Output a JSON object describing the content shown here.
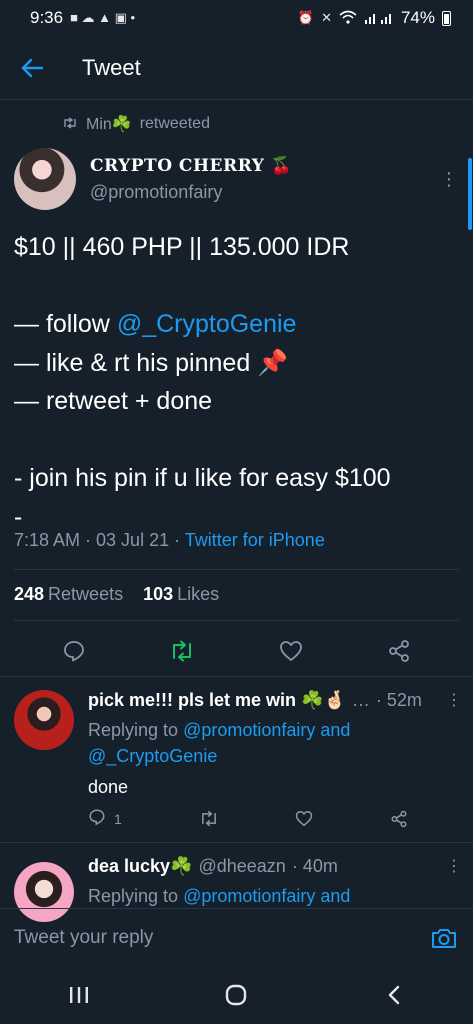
{
  "status_bar": {
    "time": "9:36",
    "battery": "74%"
  },
  "header": {
    "title": "Tweet"
  },
  "retweet_context": {
    "retweeter": "Min☘️",
    "label": "retweeted"
  },
  "tweet": {
    "author_name": "CRYPTO CHERRY 🍒",
    "author_handle": "@promotionfairy",
    "line1": "$10 || 460 PHP || 135.000 IDR",
    "line2_prefix": "— follow ",
    "line2_mention": "@_CryptoGenie",
    "line3": "— like & rt his pinned 📌",
    "line4": "— retweet + done",
    "line5": "- join his pin if u like for easy $100",
    "line6": "-",
    "timestamp": "7:18 AM · 03 Jul 21 · ",
    "source": "Twitter for iPhone",
    "retweets_count": "248",
    "retweets_label": "Retweets",
    "likes_count": "103",
    "likes_label": "Likes"
  },
  "replies": [
    {
      "name": "pick me!!! pls let me win ☘️🤞🏻",
      "ellipsis": "…",
      "time": "· 52m",
      "replying_label": "Replying to ",
      "replying_to_1": "@promotionfairy",
      "and_label": " and",
      "replying_to_2": "@_CryptoGenie",
      "text": "done",
      "reply_count": "1"
    },
    {
      "name": "dea lucky☘️",
      "handle": "@dheeazn",
      "time": "· 40m",
      "replying_label": "Replying to ",
      "replying_to_1": "@promotionfairy",
      "and_label": " and"
    }
  ],
  "compose": {
    "placeholder": "Tweet your reply"
  },
  "colors": {
    "background": "#15202b",
    "accent": "#1d9bf0",
    "retweet_active": "#17bf63",
    "secondary_text": "#8899a6"
  }
}
